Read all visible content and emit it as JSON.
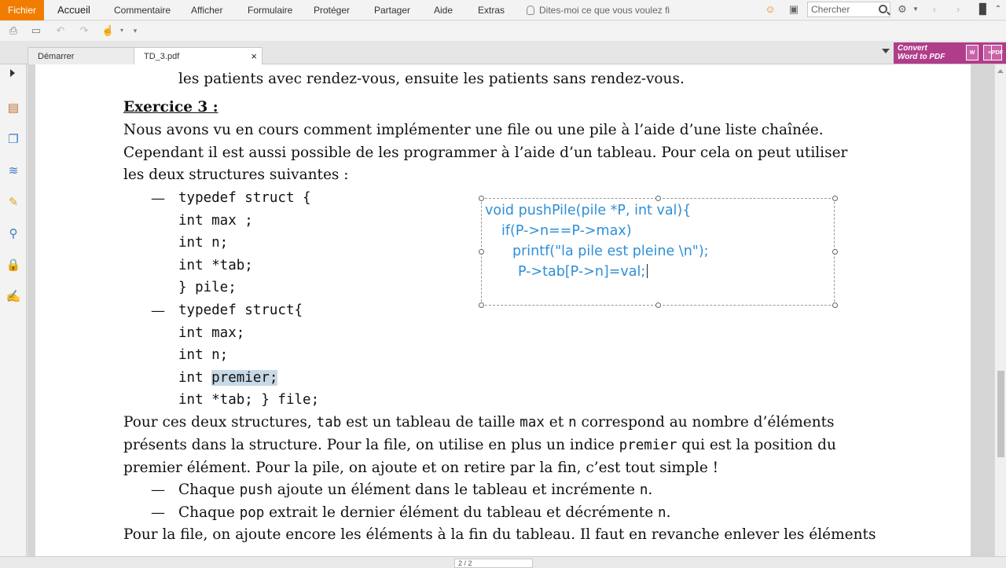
{
  "menubar": {
    "file": "Fichier",
    "items": [
      "Accueil",
      "Commentaire",
      "Afficher",
      "Formulaire",
      "Protéger",
      "Partager",
      "Aide",
      "Extras"
    ],
    "tell_me": "Dites-moi ce que vous voulez fi",
    "search_placeholder": "Chercher"
  },
  "tabs": {
    "start": "Démarrer",
    "document": "TD_3.pdf",
    "close": "×"
  },
  "convert": {
    "line1": "Convert",
    "line2": "Word to PDF"
  },
  "document": {
    "line0": "les patients avec rendez-vous, ensuite les patients sans rendez-vous.",
    "heading": "Exercice 3 :",
    "p1_l1": "Nous avons vu en cours comment implémenter une file ou une pile à l’aide d’une liste chaînée.",
    "p1_l2": "Cependant il est aussi possible de les programmer à l’aide d’un tableau. Pour cela on peut utiliser",
    "p1_l3": "les deux structures suivantes :",
    "dash": "—",
    "s1": [
      "typedef struct {",
      "int max ;",
      "int n;",
      "int *tab;",
      "} pile;"
    ],
    "s2": [
      "typedef struct{",
      "int max;",
      "int n;"
    ],
    "s2_int": "int ",
    "s2_premier": "premier;",
    "s2_last": "int *tab; } file;",
    "p2_l1_a": "Pour ces deux structures, ",
    "p2_l1_tab": "tab",
    "p2_l1_b": " est un tableau de taille ",
    "p2_l1_max": "max",
    "p2_l1_c": " et ",
    "p2_l1_n": "n",
    "p2_l1_d": " correspond au nombre d’éléments",
    "p2_l2_a": "présents dans la structure. Pour la file, on utilise en plus un indice ",
    "p2_l2_premier": "premier",
    "p2_l2_b": " qui est la position du",
    "p2_l3": "premier élément. Pour la pile, on ajoute et on retire par la fin, c’est tout simple !",
    "b1_a": "Chaque ",
    "b1_push": "push",
    "b1_b": " ajoute un élément dans le tableau et incrémente ",
    "b1_n": "n",
    "b1_c": ".",
    "b2_a": "Chaque ",
    "b2_pop": "pop",
    "b2_b": " extrait le dernier élément du tableau et décrémente ",
    "b2_n": "n",
    "b2_c": ".",
    "p3": "Pour la file, on ajoute encore les éléments à la fin du tableau. Il faut en revanche enlever les éléments"
  },
  "annotation": {
    "lines": [
      "void pushPile(pile *P, int val){",
      "if(P->n==P->max)",
      "printf(\"la pile est pleine \\n\");",
      "P->tab[P->n]=val;"
    ],
    "color": "#2f8fd6"
  },
  "statusbar": {
    "page": "2 / 2"
  },
  "colors": {
    "file_menu": "#f07d00",
    "convert_banner": "#b03d8a",
    "highlight": "#c7d8e6"
  }
}
